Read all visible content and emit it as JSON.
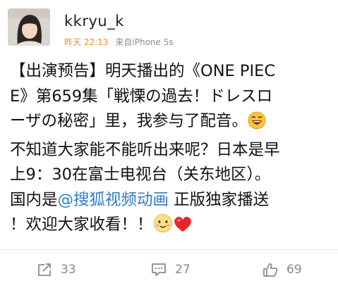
{
  "post": {
    "username": "kkryu_k",
    "time": "昨天 22:13",
    "source": "来自iPhone 5s",
    "content_lines": [
      "【出演预告】明天播出的《ONE PIEC",
      "E》第659集「戦慄の過去！ドレスロ",
      "ーザの秘密」里，我参与了配音。",
      "不知道大家能不能听出来呢？日本是早",
      "上9：30在富士电视台（关东地区）。",
      "国内是",
      "@搜狐视频动画",
      " 正版独家播送",
      "！欢迎大家收看！！"
    ],
    "emojis": [
      "laughing-emoji",
      "blushing-smile-emoji",
      "red-heart-emoji"
    ]
  },
  "actions": {
    "repost_count": "33",
    "comment_count": "27",
    "like_count": "69"
  },
  "colors": {
    "time": "#f08a2a",
    "mention": "#2f7bc9",
    "text": "#111111",
    "meta": "#8b8b8b"
  }
}
